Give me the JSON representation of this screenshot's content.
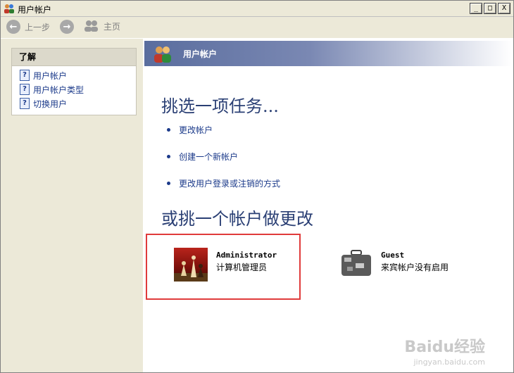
{
  "window": {
    "title": "用户帐户",
    "min_btn": "_",
    "max_btn": "□",
    "close_btn": "X"
  },
  "toolbar": {
    "back_label": "上一步",
    "home_label": "主页"
  },
  "learn": {
    "title": "了解",
    "items": [
      {
        "label": "用户帐户"
      },
      {
        "label": "用户帐户类型"
      },
      {
        "label": "切换用户"
      }
    ]
  },
  "banner": {
    "title": "用户帐户"
  },
  "main": {
    "heading_task": "挑选一项任务...",
    "tasks": [
      {
        "label": "更改帐户"
      },
      {
        "label": "创建一个新帐户"
      },
      {
        "label": "更改用户登录或注销的方式"
      }
    ],
    "heading_account": "或挑一个帐户做更改",
    "accounts": [
      {
        "name": "Administrator",
        "desc": "计算机管理员"
      },
      {
        "name": "Guest",
        "desc": "来宾帐户没有启用"
      }
    ]
  },
  "watermark": {
    "brand": "Baidu经验",
    "url": "jingyan.baidu.com"
  }
}
